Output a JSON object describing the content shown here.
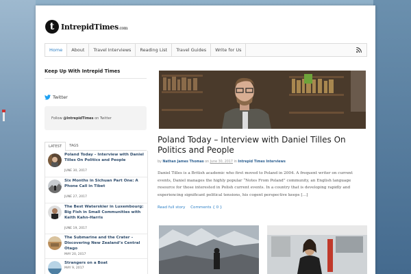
{
  "logo": {
    "mark": "t",
    "name": "IntrepidTimes",
    "domain": ".com"
  },
  "nav": {
    "items": [
      "Home",
      "About",
      "Travel Interviews",
      "Reading List",
      "Travel Guides",
      "Write for Us"
    ],
    "active": "Home",
    "rss_icon": "rss-icon"
  },
  "sidebar": {
    "title": "Keep Up With Intrepid Times",
    "twitter": {
      "label": "Twitter",
      "follow_prefix": "Follow ",
      "handle": "@IntrepidTimes",
      "follow_suffix": " on Twitter"
    },
    "tabs": [
      "LATEST",
      "TAGS"
    ],
    "active_tab": "LATEST",
    "posts": [
      {
        "title": "Poland Today – Interview with Daniel Tilles On Politics and People",
        "date": "JUNE 30, 2017"
      },
      {
        "title": "Six Months in Sichuan Part One: A Phone Call in Tibet",
        "date": "JUNE 27, 2017"
      },
      {
        "title": "The Best Waterskier in Luxembourg: Big Fish in Small Communities with Keith Kahn-Harris",
        "date": "JUNE 19, 2017"
      },
      {
        "title": "The Submarine and the Crater – Discovering New Zealand’s Central Otago",
        "date": "MAY 20, 2017"
      },
      {
        "title": "Strangers on a Boat",
        "date": "MAY 9, 2017"
      }
    ]
  },
  "article": {
    "title": "Poland Today – Interview with Daniel Tilles On Politics and People",
    "by": "by",
    "author": "Nathan James Thomas",
    "on": "on",
    "date": "June 30, 2017",
    "in": "in",
    "category": "Intrepid Times Interviews",
    "excerpt": "Daniel Tilles is a British academic who first moved to Poland in 2004. A frequent writer on current events, Daniel manages the highly popular “Notes From Poland” community, an English language resource for those interested in Polish current events. In a country that is developing rapidly and experiencing significant political tensions, his cogent perspective keeps […]",
    "read_more": "Read full story",
    "comments": "Comments { 0 }"
  },
  "colors": {
    "accent": "#2b7fc6",
    "link_dark": "#2c4a6a",
    "twitter": "#1da1f2"
  }
}
